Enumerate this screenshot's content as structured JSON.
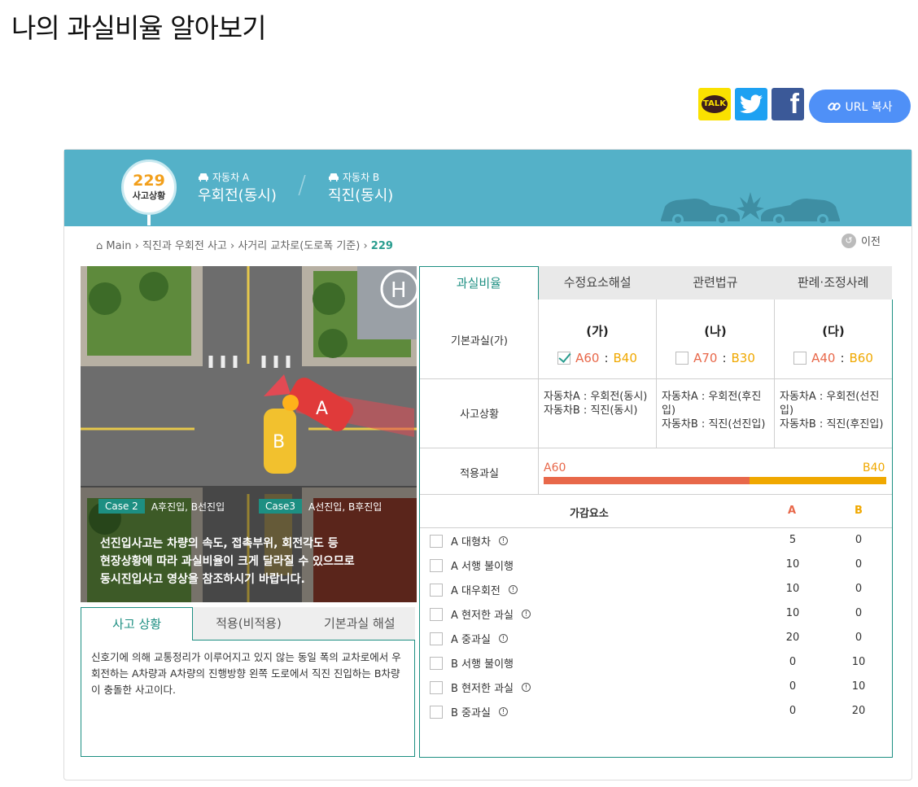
{
  "page_title": "나의 과실비율 알아보기",
  "share": {
    "kakao": "TALK",
    "facebook": "f",
    "url_copy": "URL 복사"
  },
  "case": {
    "number": "229",
    "label": "사고상황",
    "car_a": {
      "label": "자동차 A",
      "value": "우회전(동시)"
    },
    "car_b": {
      "label": "자동차 B",
      "value": "직진(동시)"
    }
  },
  "breadcrumb": {
    "home": "Main",
    "c1": "직진과 우회전 사고",
    "c2": "사거리 교차로(도로폭 기준)",
    "current": "229"
  },
  "prev_label": "이전",
  "scene": {
    "case2_tag": "Case 2",
    "case2_text": "A후진입, B선진입",
    "case3_tag": "Case3",
    "case3_text": "A선진입, B후진입",
    "notice1": "선진입사고는 차량의 속도, 접촉부위, 회전각도 등",
    "notice2": "현장상황에 따라 과실비율이 크게 달라질 수 있으므로",
    "notice3": "동시진입사고 영상을 참조하시기 바랍니다.",
    "car_a": "A",
    "car_b": "B"
  },
  "left_tabs": [
    "사고 상황",
    "적용(비적용)",
    "기본과실 해설"
  ],
  "description": "신호기에 의해 교통정리가 이루어지고 있지 않는 동일 폭의 교차로에서 우회전하는 A차량과 A차량의 진행방향 왼쪽 도로에서 직진 진입하는 B차량이 충돌한 사고이다.",
  "right_tabs": [
    "과실비율",
    "수정요소해설",
    "관련법규",
    "판례·조정사례"
  ],
  "base_fault": {
    "label": "기본과실(가)",
    "options": [
      {
        "head": "(가)",
        "a": "A60",
        "b": "B40",
        "checked": true
      },
      {
        "head": "(나)",
        "a": "A70",
        "b": "B30",
        "checked": false
      },
      {
        "head": "(다)",
        "a": "A40",
        "b": "B60",
        "checked": false
      }
    ]
  },
  "situation": {
    "label": "사고상황",
    "cols": [
      {
        "a": "자동차A : 우회전(동시)",
        "b": "자동차B : 직진(동시)"
      },
      {
        "a": "자동차A : 우회전(후진입)",
        "b": "자동차B : 직진(선진입)"
      },
      {
        "a": "자동차A : 우회전(선진입)",
        "b": "자동차B : 직진(후진입)"
      }
    ]
  },
  "applied": {
    "label": "적용과실",
    "a_label": "A60",
    "b_label": "B40",
    "a_value": 60,
    "b_value": 40
  },
  "factors": {
    "header": "가감요소",
    "col_a": "A",
    "col_b": "B",
    "rows": [
      {
        "name": "A 대형차",
        "info": true,
        "a": "5",
        "b": "0"
      },
      {
        "name": "A 서행 불이행",
        "info": false,
        "a": "10",
        "b": "0"
      },
      {
        "name": "A 대우회전",
        "info": true,
        "a": "10",
        "b": "0"
      },
      {
        "name": "A 현저한 과실",
        "info": true,
        "a": "10",
        "b": "0"
      },
      {
        "name": "A 중과실",
        "info": true,
        "a": "20",
        "b": "0"
      },
      {
        "name": "B 서행 불이행",
        "info": false,
        "a": "0",
        "b": "10"
      },
      {
        "name": "B 현저한 과실",
        "info": true,
        "a": "0",
        "b": "10"
      },
      {
        "name": "B 중과실",
        "info": true,
        "a": "0",
        "b": "20"
      }
    ]
  },
  "colors": {
    "teal": "#1d8f82",
    "banner": "#54b1c8",
    "a": "#e8684a",
    "b": "#f0a800"
  }
}
